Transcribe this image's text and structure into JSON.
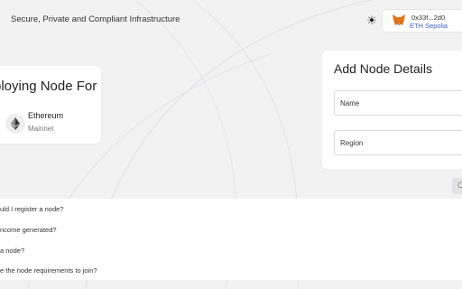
{
  "header": {
    "tagline": "Secure, Private and Compliant Infrastructure",
    "theme_icon": "sun-icon"
  },
  "wallet": {
    "icon": "metamask-fox-icon",
    "address": "0x33f...2d0",
    "network": "ETH Sepolia",
    "status_color": "#22c55e"
  },
  "deploy_card": {
    "title": "ploying Node For",
    "chain_icon": "ethereum-icon",
    "chain_name": "Ethereum",
    "chain_type": "Mainnet"
  },
  "details_card": {
    "title": "Add Node Details",
    "fields": [
      {
        "label": "Name"
      },
      {
        "label": "Region"
      }
    ]
  },
  "cta": {
    "label": "C"
  },
  "faq": {
    "items": [
      "uld I register a node?",
      "ncome generated?",
      "a node?",
      "e the node requirements to join?"
    ]
  },
  "colors": {
    "background": "#f2f2f3",
    "card": "#ffffff",
    "accent": "#3d5ce0"
  }
}
